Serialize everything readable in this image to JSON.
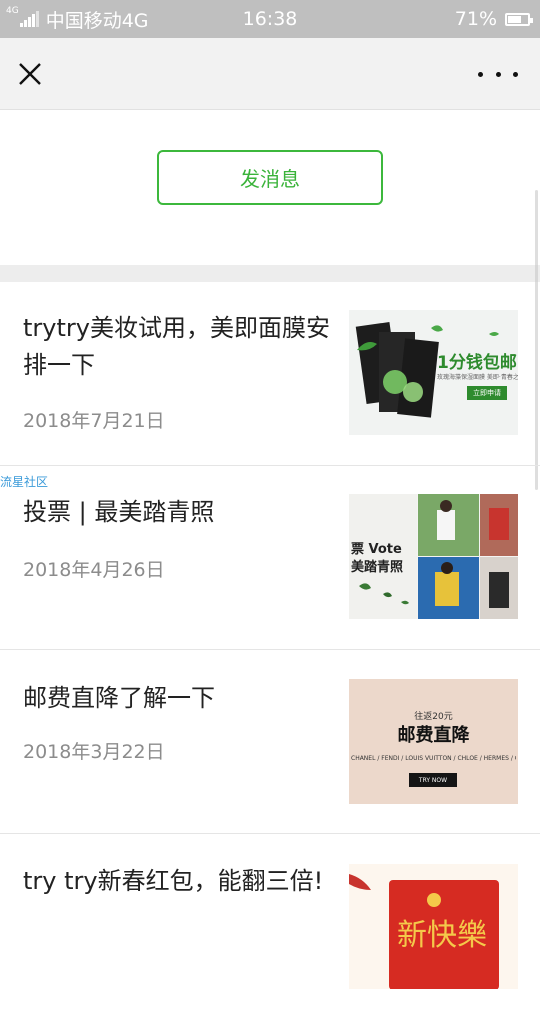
{
  "status_bar": {
    "network_badge": "4G",
    "carrier": "中国移动4G",
    "time": "16:38",
    "battery_text": "71%",
    "battery_level": 0.71
  },
  "nav": {
    "close_icon": "close-icon",
    "more_icon": "more-dots-icon"
  },
  "profile": {
    "send_message_label": "发消息"
  },
  "watermark": "流星社区",
  "articles": [
    {
      "title": "trytry美妆试用，美即面膜安排一下",
      "date": "2018年7月21日",
      "thumb": {
        "headline": "1分钱包邮",
        "subline": "玫瑰海藻保湿面膜 美即·青春之水",
        "button": "立即申请"
      }
    },
    {
      "title": "投票 | 最美踏青照",
      "date": "2018年4月26日",
      "thumb": {
        "line1": "票 Vote",
        "line2": "美踏青照"
      }
    },
    {
      "title": "邮费直降了解一下",
      "date": "2018年3月22日",
      "thumb": {
        "small": "往返20元",
        "headline": "邮费直降",
        "brands": "CHANEL / FENDI / LOUIS VUITTON / CHLOE / HERMES / GUCCI / CE",
        "button": "TRY NOW"
      }
    },
    {
      "title": "try try新春红包，能翻三倍!",
      "date": "",
      "thumb": {
        "calligraphy": "新快樂"
      }
    }
  ],
  "colors": {
    "status_bar_bg": "#bfbfbf",
    "nav_bg": "#f2f2f2",
    "accent_green": "#3cb83c",
    "divider": "#ededed"
  }
}
